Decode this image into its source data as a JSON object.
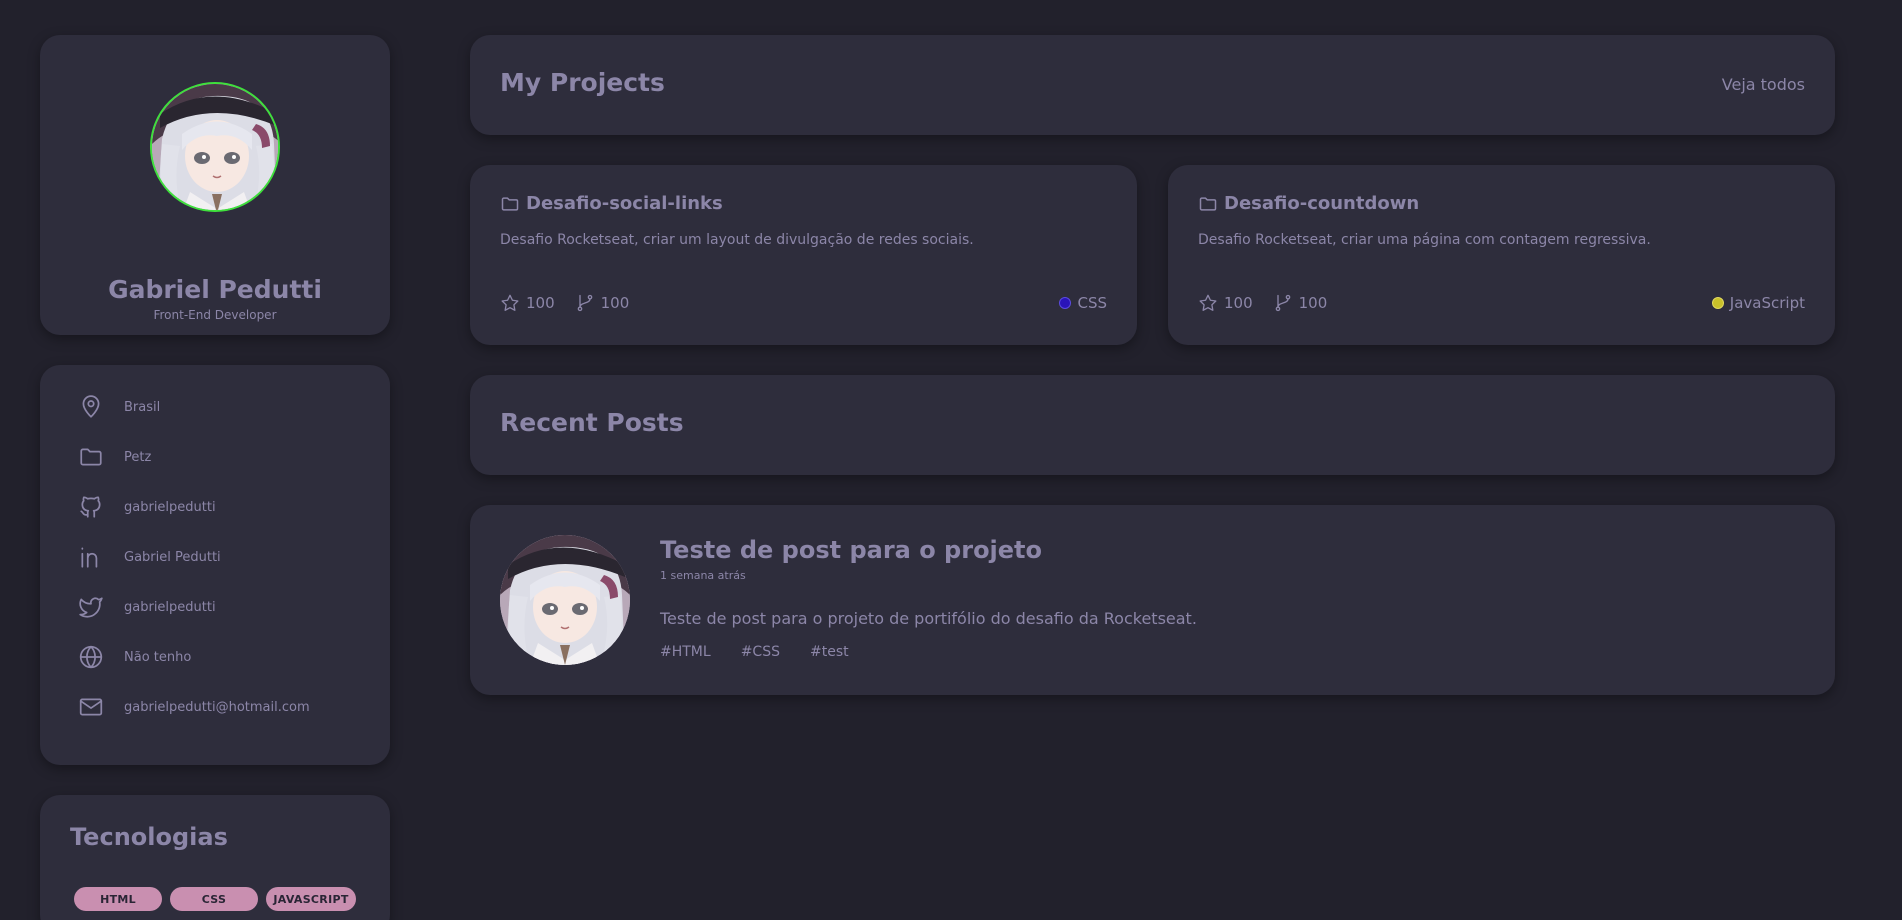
{
  "profile": {
    "name": "Gabriel Pedutti",
    "role": "Front-End Developer",
    "avatar_border": "#3fe03c"
  },
  "info": [
    {
      "icon": "map-pin-icon",
      "text": "Brasil"
    },
    {
      "icon": "folder-icon",
      "text": "Petz"
    },
    {
      "icon": "github-icon",
      "text": "gabrielpedutti"
    },
    {
      "icon": "linkedin-icon",
      "text": "Gabriel Pedutti"
    },
    {
      "icon": "twitter-icon",
      "text": "gabrielpedutti"
    },
    {
      "icon": "globe-icon",
      "text": "Não tenho"
    },
    {
      "icon": "mail-icon",
      "text": "gabrielpedutti@hotmail.com"
    }
  ],
  "technologies": {
    "title": "Tecnologias",
    "items": [
      "HTML",
      "CSS",
      "JAVASCRIPT"
    ],
    "badge_color": "#c98fb0"
  },
  "projects": {
    "title": "My Projects",
    "see_all": "Veja todos",
    "items": [
      {
        "name": "Desafio-social-links",
        "description": "Desafio Rocketseat, criar um layout de divulgação de redes sociais.",
        "stars": "100",
        "forks": "100",
        "language": "CSS",
        "language_color": "#2a14b8"
      },
      {
        "name": "Desafio-countdown",
        "description": "Desafio Rocketseat, criar uma página com contagem regressiva.",
        "stars": "100",
        "forks": "100",
        "language": "JavaScript",
        "language_color": "#c9c12a"
      }
    ]
  },
  "posts": {
    "title": "Recent Posts",
    "items": [
      {
        "title": "Teste de post para o projeto",
        "date": "1 semana atrás",
        "body": "Teste de post para o projeto de portifólio do desafio da Rocketseat.",
        "tags": [
          "#HTML",
          "#CSS",
          "#test"
        ]
      }
    ]
  },
  "colors": {
    "background": "#22212c",
    "card": "#2e2d3c",
    "text": "#8c86a8"
  }
}
